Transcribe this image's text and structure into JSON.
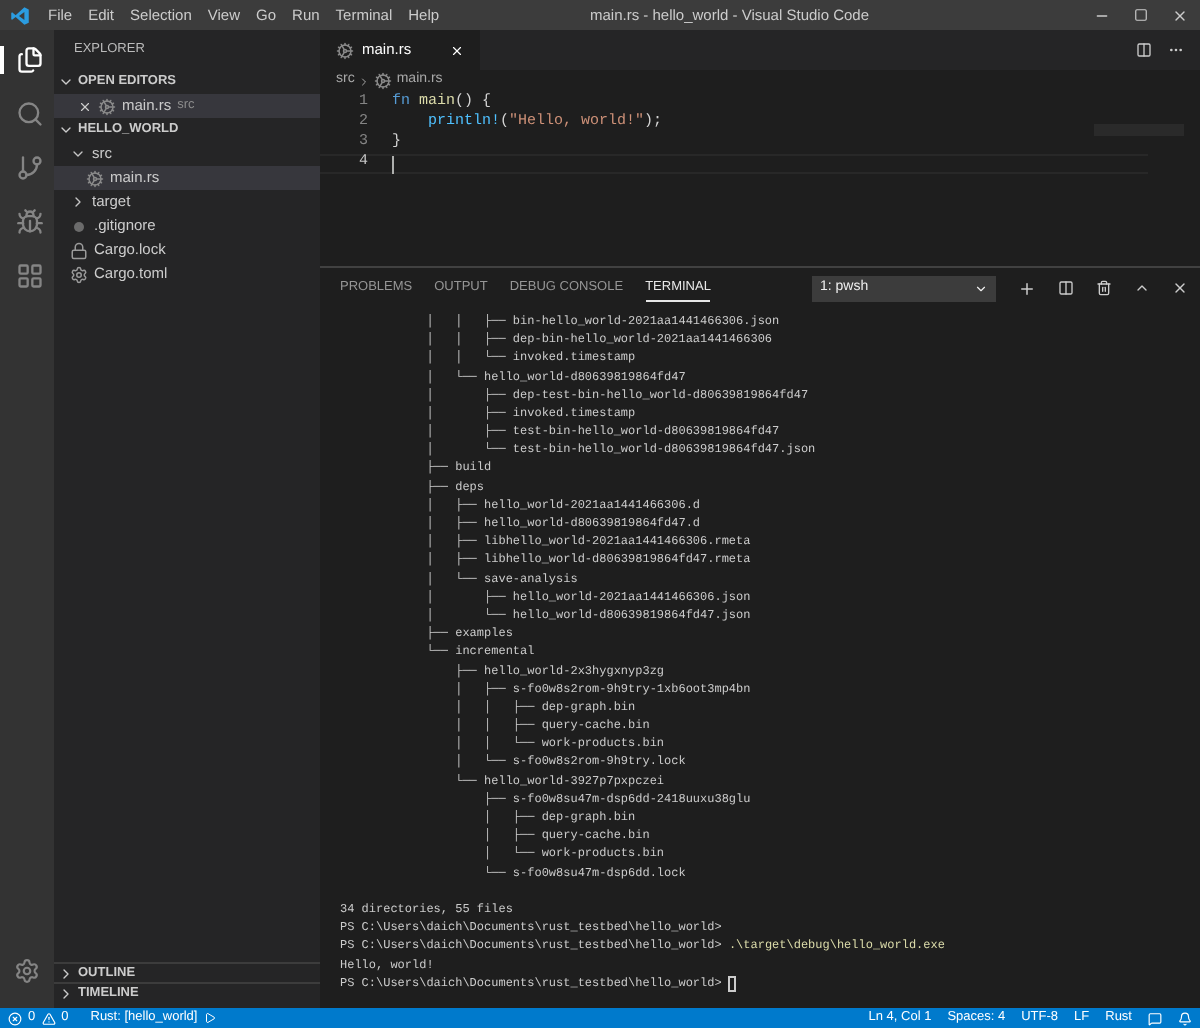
{
  "title_bar": {
    "menu": [
      "File",
      "Edit",
      "Selection",
      "View",
      "Go",
      "Run",
      "Terminal",
      "Help"
    ],
    "title": "main.rs - hello_world - Visual Studio Code"
  },
  "activity_bar": [
    {
      "kind": "files",
      "selected": true
    },
    {
      "kind": "search",
      "selected": false
    },
    {
      "kind": "source-control",
      "selected": false
    },
    {
      "kind": "run",
      "selected": false
    },
    {
      "kind": "extensions",
      "selected": false
    }
  ],
  "sidebar": {
    "title": "EXPLORER",
    "open_editors": {
      "title": "OPEN EDITORS",
      "expanded": true,
      "items": [
        {
          "name": "main.rs",
          "description": "src",
          "selected": true
        }
      ]
    },
    "folder": {
      "title": "HELLO_WORLD",
      "expanded": true,
      "children": [
        {
          "name": "src",
          "kind": "folder",
          "expanded": true,
          "selected": false,
          "children": [
            {
              "name": "main.rs",
              "kind": "rust",
              "selected": true
            }
          ]
        },
        {
          "name": "target",
          "kind": "folder",
          "expanded": false,
          "selected": false
        },
        {
          "name": ".gitignore",
          "kind": "gitignore",
          "selected": false
        },
        {
          "name": "Cargo.lock",
          "kind": "lock",
          "selected": false
        },
        {
          "name": "Cargo.toml",
          "kind": "toml",
          "selected": false
        }
      ]
    },
    "bottom_sections": [
      {
        "title": "OUTLINE",
        "expanded": false
      },
      {
        "title": "TIMELINE",
        "expanded": false
      }
    ]
  },
  "editor": {
    "tabs": [
      {
        "label": "main.rs",
        "selected": true
      }
    ],
    "breadcrumbs": [
      "src",
      "main.rs"
    ],
    "lines": [
      {
        "number": "1",
        "current": false,
        "indented": false,
        "tokens": [
          {
            "kind": "keyword",
            "text": "fn "
          },
          {
            "kind": "function",
            "text": "main"
          },
          {
            "kind": "plain",
            "text": "() {"
          }
        ]
      },
      {
        "number": "2",
        "current": false,
        "indented": true,
        "tokens": [
          {
            "kind": "macro",
            "text": "println!"
          },
          {
            "kind": "plain",
            "text": "("
          },
          {
            "kind": "string",
            "text": "\"Hello, world!\""
          },
          {
            "kind": "plain",
            "text": ");"
          }
        ]
      },
      {
        "number": "3",
        "current": false,
        "indented": false,
        "tokens": [
          {
            "kind": "plain",
            "text": "}"
          }
        ]
      },
      {
        "number": "4",
        "current": true,
        "indented": false
      }
    ]
  },
  "panel": {
    "tabs": [
      {
        "label": "PROBLEMS",
        "selected": false
      },
      {
        "label": "OUTPUT",
        "selected": false
      },
      {
        "label": "DEBUG CONSOLE",
        "selected": false
      },
      {
        "label": "TERMINAL",
        "selected": true
      }
    ],
    "terminal_select": "1: pwsh",
    "lines": [
      {
        "text": "            │   │   ├── bin-hello_world-2021aa1441466306.json",
        "space_before": false
      },
      {
        "text": "            │   │   ├── dep-bin-hello_world-2021aa1441466306",
        "space_before": false
      },
      {
        "text": "            │   │   └── invoked.timestamp",
        "space_before": false
      },
      {
        "text": "            │   └── hello_world-d80639819864fd47",
        "space_before": false
      },
      {
        "text": "            │       ├── dep-test-bin-hello_world-d80639819864fd47",
        "space_before": false
      },
      {
        "text": "            │       ├── invoked.timestamp",
        "space_before": false
      },
      {
        "text": "            │       ├── test-bin-hello_world-d80639819864fd47",
        "space_before": false
      },
      {
        "text": "            │       └── test-bin-hello_world-d80639819864fd47.json",
        "space_before": false
      },
      {
        "text": "            ├── build",
        "space_before": false
      },
      {
        "text": "            ├── deps",
        "space_before": false
      },
      {
        "text": "            │   ├── hello_world-2021aa1441466306.d",
        "space_before": false
      },
      {
        "text": "            │   ├── hello_world-d80639819864fd47.d",
        "space_before": false
      },
      {
        "text": "            │   ├── libhello_world-2021aa1441466306.rmeta",
        "space_before": false
      },
      {
        "text": "            │   ├── libhello_world-d80639819864fd47.rmeta",
        "space_before": false
      },
      {
        "text": "            │   └── save-analysis",
        "space_before": false
      },
      {
        "text": "            │       ├── hello_world-2021aa1441466306.json",
        "space_before": false
      },
      {
        "text": "            │       └── hello_world-d80639819864fd47.json",
        "space_before": false
      },
      {
        "text": "            ├── examples",
        "space_before": false
      },
      {
        "text": "            └── incremental",
        "space_before": false
      },
      {
        "text": "                ├── hello_world-2x3hygxnyp3zg",
        "space_before": false
      },
      {
        "text": "                │   ├── s-fo0w8s2rom-9h9try-1xb6oot3mp4bn",
        "space_before": false
      },
      {
        "text": "                │   │   ├── dep-graph.bin",
        "space_before": false
      },
      {
        "text": "                │   │   ├── query-cache.bin",
        "space_before": false
      },
      {
        "text": "                │   │   └── work-products.bin",
        "space_before": false
      },
      {
        "text": "                │   └── s-fo0w8s2rom-9h9try.lock",
        "space_before": false
      },
      {
        "text": "                └── hello_world-3927p7pxpczei",
        "space_before": false
      },
      {
        "text": "                    ├── s-fo0w8su47m-dsp6dd-2418uuxu38glu",
        "space_before": false
      },
      {
        "text": "                    │   ├── dep-graph.bin",
        "space_before": false
      },
      {
        "text": "                    │   ├── query-cache.bin",
        "space_before": false
      },
      {
        "text": "                    │   └── work-products.bin",
        "space_before": false
      },
      {
        "text": "                    └── s-fo0w8su47m-dsp6dd.lock",
        "space_before": false
      },
      {
        "text": "34 directories, 55 files",
        "space_before": true
      },
      {
        "text": "PS C:\\Users\\daich\\Documents\\rust_testbed\\hello_world>",
        "space_before": false
      },
      {
        "text": "PS C:\\Users\\daich\\Documents\\rust_testbed\\hello_world>",
        "command": ".\\target\\debug\\hello_world.exe",
        "space_before": false
      },
      {
        "text": "Hello, world!",
        "space_before": false
      },
      {
        "text": "PS C:\\Users\\daich\\Documents\\rust_testbed\\hello_world>",
        "cursor": true,
        "space_before": false
      }
    ]
  },
  "status_bar": {
    "errors": "0",
    "warnings": "0",
    "project": "Rust: [hello_world]",
    "right": [
      "Ln 4, Col 1",
      "Spaces: 4",
      "UTF-8",
      "LF",
      "Rust"
    ]
  }
}
